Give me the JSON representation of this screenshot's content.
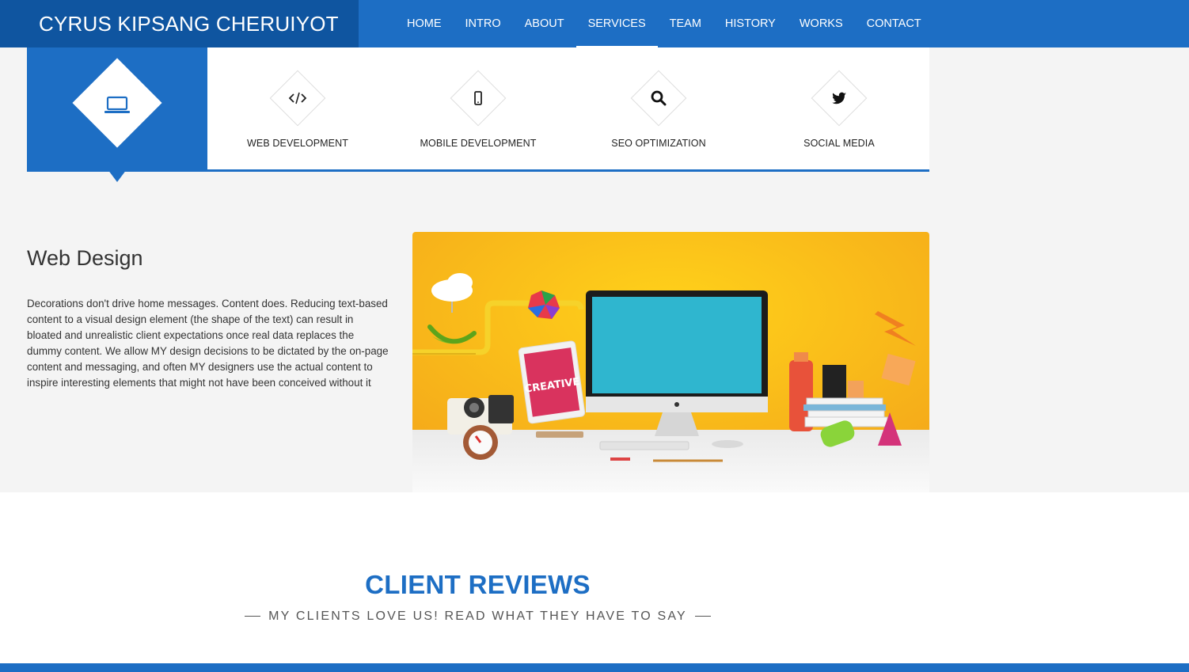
{
  "brand": "CYRUS KIPSANG CHERUIYOT",
  "nav": {
    "items": [
      {
        "label": "HOME"
      },
      {
        "label": "INTRO"
      },
      {
        "label": "ABOUT"
      },
      {
        "label": "SERVICES"
      },
      {
        "label": "TEAM"
      },
      {
        "label": "HISTORY"
      },
      {
        "label": "WORKS"
      },
      {
        "label": "CONTACT"
      }
    ],
    "active": "SERVICES"
  },
  "services": {
    "main_icon": "laptop-icon",
    "items": [
      {
        "label": "WEB DEVELOPMENT",
        "icon": "code-icon"
      },
      {
        "label": "MOBILE DEVELOPMENT",
        "icon": "mobile-icon"
      },
      {
        "label": "SEO OPTIMIZATION",
        "icon": "search-icon"
      },
      {
        "label": "SOCIAL MEDIA",
        "icon": "twitter-icon"
      }
    ]
  },
  "web_design": {
    "title": "Web Design",
    "body": "Decorations don't drive home messages. Content does. Reducing text-based content to a visual design element (the shape of the text) can result in bloated and unrealistic client expectations once real data replaces the dummy content. We allow MY design decisions to be dictated by the on-page content and messaging, and often MY designers use the actual content to inspire interesting elements that might not have been conceived without it",
    "image_text": "CREATIVE"
  },
  "reviews": {
    "title": "CLIENT REVIEWS",
    "subtitle": "MY CLIENTS LOVE US! READ WHAT THEY HAVE TO SAY"
  },
  "colors": {
    "primary": "#1d6ec4",
    "brand_bg": "#0f55a0",
    "page_bg": "#f4f4f4",
    "image_bg": "#f7b81a",
    "monitor_screen": "#2fb6cf"
  }
}
